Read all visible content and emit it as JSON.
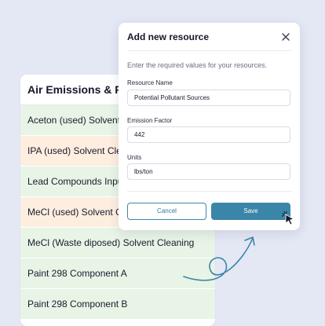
{
  "background_list": {
    "title": "Air Emissions & Reports",
    "rows": [
      {
        "label": "Aceton (used) Solvent",
        "tint": "green"
      },
      {
        "label": "IPA (used) Solvent Cleaning",
        "tint": "orange"
      },
      {
        "label": "Lead Compounds Input",
        "tint": "green"
      },
      {
        "label": "MeCl (used) Solvent Cleaning",
        "tint": "orange"
      },
      {
        "label": "MeCl (Waste diposed) Solvent Cleaning",
        "tint": "green"
      },
      {
        "label": "Paint 298 Component A",
        "tint": "green"
      },
      {
        "label": "Paint 298 Component B",
        "tint": "green"
      }
    ]
  },
  "modal": {
    "title": "Add new resource",
    "description": "Enter the required values for your resources.",
    "fields": [
      {
        "label": "Resource Name",
        "value": "Potential Pollutant Sources"
      },
      {
        "label": "Emission Factor",
        "value": "442"
      },
      {
        "label": "Units",
        "value": "lbs/ton"
      }
    ],
    "cancel_label": "Cancel",
    "save_label": "Save"
  },
  "icons": {
    "close": "close-icon",
    "cursor": "pointer-cursor-icon",
    "arrow": "curved-arrow-icon"
  },
  "colors": {
    "background": "#e4e7f4",
    "accent": "#3a86a8",
    "row_green": "#e8f4e6",
    "row_orange": "#fdeee0"
  }
}
